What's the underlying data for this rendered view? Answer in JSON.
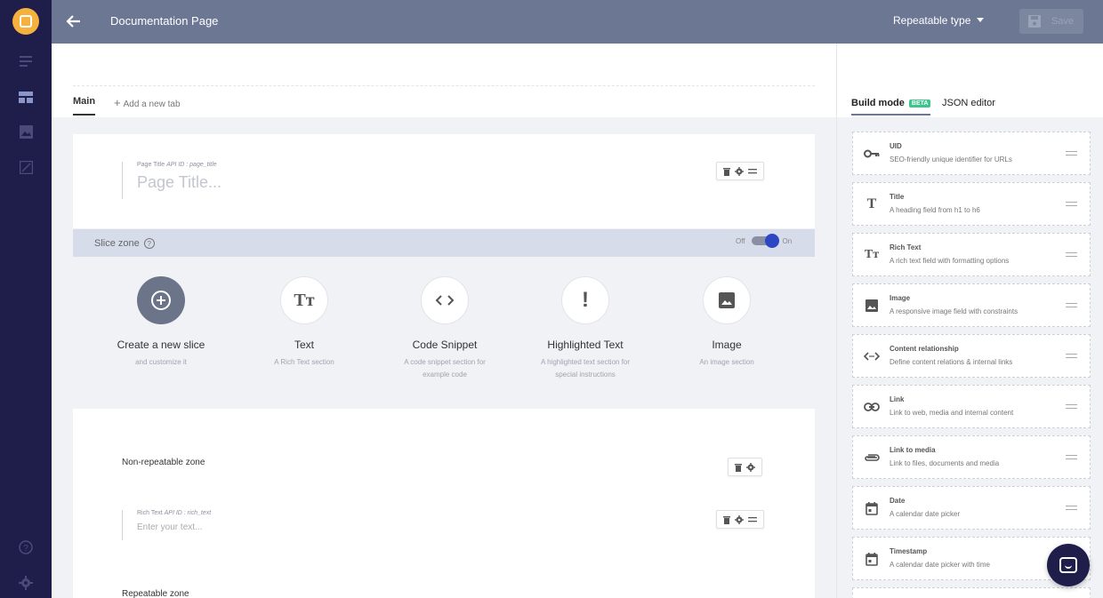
{
  "header": {
    "title": "Documentation Page",
    "repeatable_type": "Repeatable type",
    "save_label": "Save"
  },
  "tabs": {
    "main": "Main",
    "add_tab": "Add a new tab"
  },
  "right_tabs": {
    "build_mode": "Build mode",
    "beta": "BETA",
    "json_editor": "JSON editor"
  },
  "page_title_field": {
    "label": "Page Title",
    "api_id": "API ID : page_title",
    "placeholder": "Page Title..."
  },
  "slice_zone": {
    "label": "Slice zone",
    "help": "?",
    "off": "Off",
    "on": "On",
    "enabled": true,
    "slices": [
      {
        "name": "Create a new slice",
        "desc": "and customize it",
        "icon": "plus-circle-icon"
      },
      {
        "name": "Text",
        "desc": "A Rich Text section",
        "icon": "text-icon"
      },
      {
        "name": "Code Snippet",
        "desc": "A code snippet section for example code",
        "icon": "code-icon"
      },
      {
        "name": "Highlighted Text",
        "desc": "A highlighted text section for special instructions",
        "icon": "exclamation-icon"
      },
      {
        "name": "Image",
        "desc": "An image section",
        "icon": "image-icon"
      }
    ]
  },
  "zones": {
    "non_repeatable": "Non-repeatable zone",
    "repeatable": "Repeatable zone",
    "rich_text_label": "Rich Text",
    "rich_text_api": "API ID : rich_text",
    "rich_text_placeholder": "Enter your text..."
  },
  "fields": [
    {
      "name": "UID",
      "desc": "SEO-friendly unique identifier for URLs",
      "icon": "key-icon"
    },
    {
      "name": "Title",
      "desc": "A heading field from h1 to h6",
      "icon": "title-icon"
    },
    {
      "name": "Rich Text",
      "desc": "A rich text field with formatting options",
      "icon": "rich-text-icon"
    },
    {
      "name": "Image",
      "desc": "A responsive image field with constraints",
      "icon": "image-icon"
    },
    {
      "name": "Content relationship",
      "desc": "Define content relations & internal links",
      "icon": "relationship-icon"
    },
    {
      "name": "Link",
      "desc": "Link to web, media and internal content",
      "icon": "link-icon"
    },
    {
      "name": "Link to media",
      "desc": "Link to files, documents and media",
      "icon": "paperclip-icon"
    },
    {
      "name": "Date",
      "desc": "A calendar date picker",
      "icon": "calendar-icon"
    },
    {
      "name": "Timestamp",
      "desc": "A calendar date picker with time",
      "icon": "calendar-icon"
    }
  ],
  "colors": {
    "sidebar": "#1f1d4a",
    "header": "#6c7793",
    "logo": "#f5b13d",
    "toggle_knob": "#2d46c4",
    "beta": "#3cc48a"
  }
}
